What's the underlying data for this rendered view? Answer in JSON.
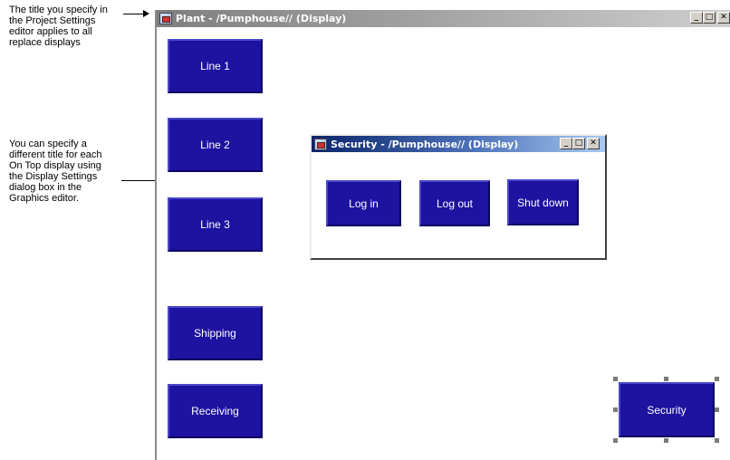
{
  "callouts": {
    "replace_title": "The title you specify in\nthe Project Settings\neditor applies to all\nreplace displays",
    "on_top_title": "You can specify a\ndifferent title for each\nOn Top display using\nthe Display Settings\ndialog box in the\nGraphics editor."
  },
  "main_window": {
    "title": "Plant - /Pumphouse// (Display)",
    "controls": {
      "minimize": "_",
      "maximize": "□",
      "close": "✕"
    },
    "buttons": {
      "line1": "Line 1",
      "line2": "Line 2",
      "line3": "Line 3",
      "shipping": "Shipping",
      "receiving": "Receiving",
      "security": "Security"
    }
  },
  "security_window": {
    "title": "Security - /Pumphouse// (Display)",
    "buttons": {
      "login": "Log in",
      "logout": "Log out",
      "shutdown": "Shut down"
    }
  },
  "icons": [
    "display-app-icon",
    "minimize-icon",
    "maximize-icon",
    "close-icon",
    "arrow-icon"
  ],
  "colors": {
    "button_fill": "#1e12a0",
    "active_title": "#0a246a",
    "inactive_title": "#7f7f7f"
  }
}
